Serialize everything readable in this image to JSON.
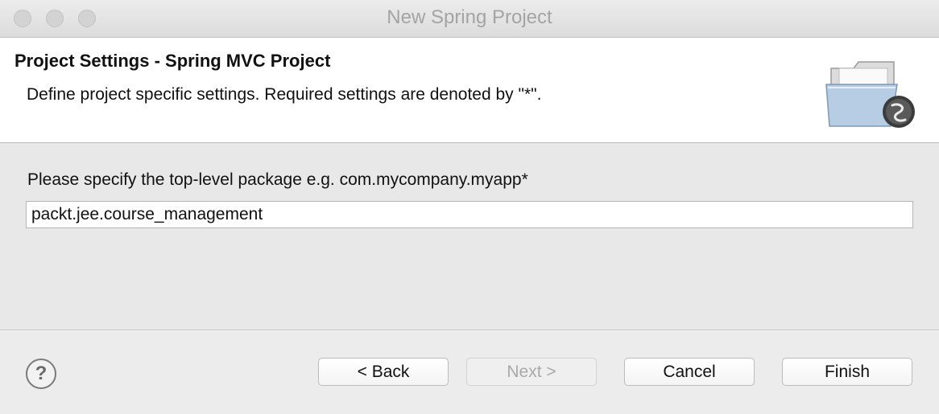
{
  "window": {
    "title": "New Spring Project"
  },
  "header": {
    "title": "Project Settings - Spring MVC Project",
    "description": "Define project specific settings. Required settings are denoted by \"*\".",
    "icon": "folder-spring-icon"
  },
  "form": {
    "package_label": "Please specify the top-level package e.g. com.mycompany.myapp*",
    "package_value": "packt.jee.course_management"
  },
  "footer": {
    "help_icon": "help-icon",
    "help_glyph": "?",
    "back_label": "< Back",
    "next_label": "Next >",
    "cancel_label": "Cancel",
    "finish_label": "Finish"
  }
}
